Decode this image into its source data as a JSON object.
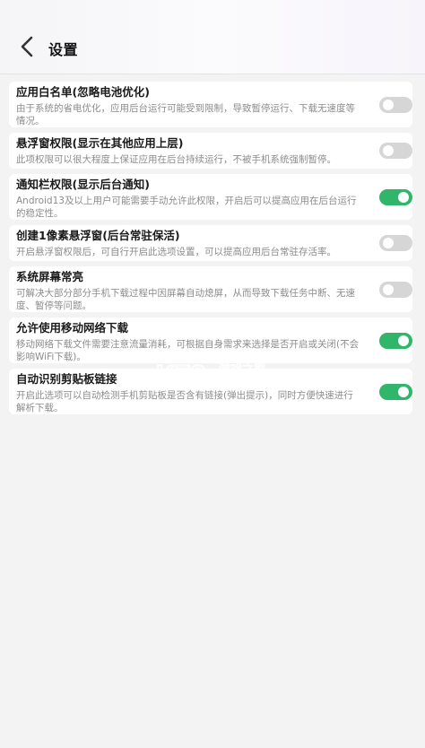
{
  "header": {
    "title": "设置",
    "back_icon": "chevron-left-icon"
  },
  "colors": {
    "toggle_on": "#2fb66a",
    "toggle_off": "#d6d6d6",
    "background": "#f3f3f3"
  },
  "settings": [
    {
      "title": "应用白名单(忽略电池优化)",
      "desc": "由于系统的省电优化，应用后台运行可能受到限制，导致暂停运行、下载无速度等情况。",
      "enabled": false
    },
    {
      "title": "悬浮窗权限(显示在其他应用上层)",
      "desc": "此项权限可以很大程度上保证应用在后台持续运行，不被手机系统强制暂停。",
      "enabled": false
    },
    {
      "title": "通知栏权限(显示后台通知)",
      "desc": "Android13及以上用户可能需要手动允许此权限，开启后可以提高应用在后台运行的稳定性。",
      "enabled": true
    },
    {
      "title": "创建1像素悬浮窗(后台常驻保活)",
      "desc": "开启悬浮窗权限后，可自行开启此选项设置，可以提高应用后台常驻存活率。",
      "enabled": false
    },
    {
      "title": "系统屏幕常亮",
      "desc": "可解决大部分部分手机下载过程中因屏幕自动熄屏，从而导致下载任务中断、无速度、暂停等问题。",
      "enabled": false
    },
    {
      "title": "允许使用移动网络下载",
      "desc": "移动网络下载文件需要注意流量消耗，可根据自身需求来选择是否开启或关闭(不会影响WiFi下载)。",
      "enabled": true
    },
    {
      "title": "自动识别剪贴板链接",
      "desc": "开启此选项可以自动检测手机剪贴板是否含有链接(弹出提示)，同时方便快速进行解析下载。",
      "enabled": true
    }
  ],
  "watermark": {
    "logo": "K73",
    "text": "游戏之家",
    "domain": ".com"
  }
}
